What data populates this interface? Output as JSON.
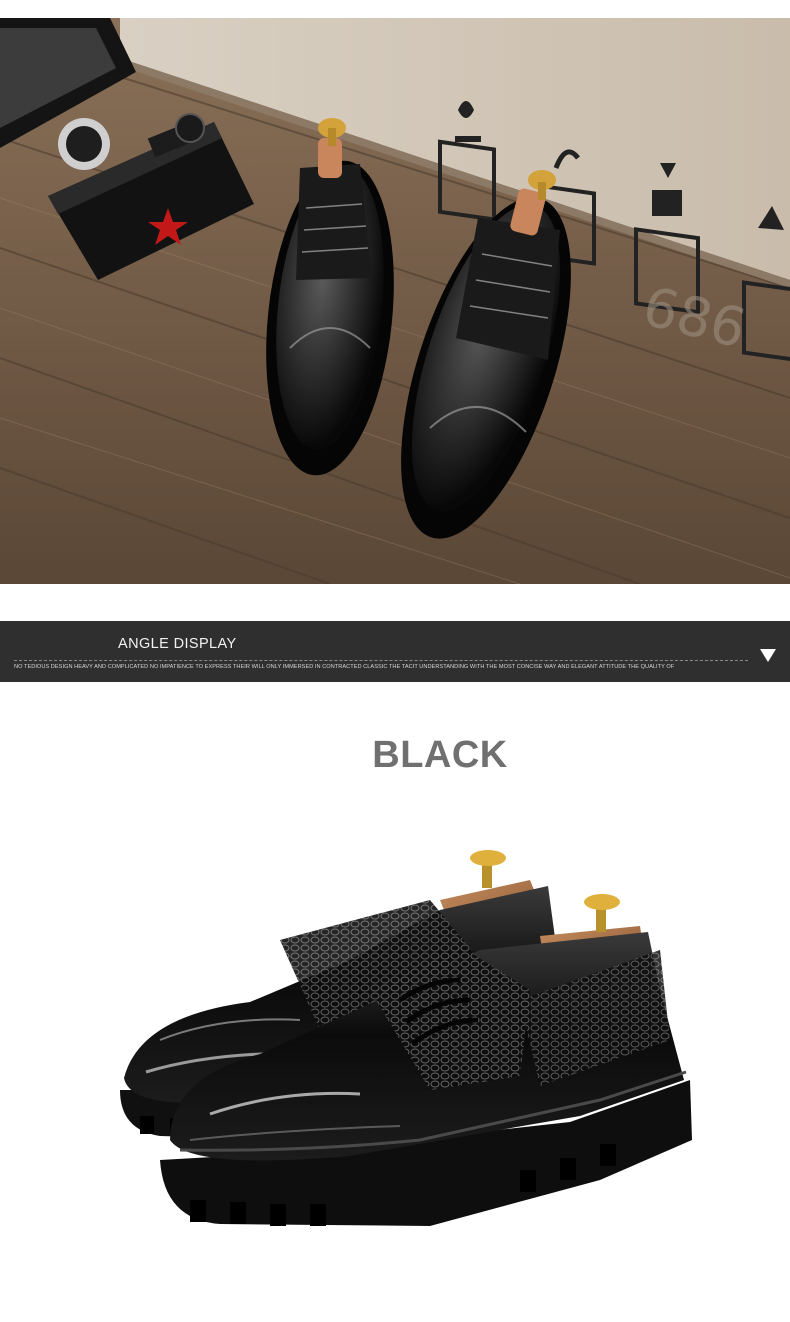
{
  "banner": {
    "title": "ANGLE DISPLAY",
    "subtitle": "NO TEDIOUS DESIGN HEAVY AND COMPLICATED NO IMPATIENCE TO EXPRESS THEIR WILL ONLY IMMERSED IN CONTRACTED CLASSIC THE TACIT UNDERSTANDING WITH THE MOST CONCISE WAY AND ELEGANT ATTITUDE THE QUALITY OF"
  },
  "product": {
    "color_label": "BLACK"
  },
  "colors": {
    "banner_bg": "#2f2f2f",
    "heading_gray": "#707070",
    "shoe_black": "#0d0d0d",
    "wood_brown": "#7a6452"
  },
  "icons": [
    "camera-icon",
    "fragile-icon",
    "keep-dry-icon",
    "this-side-up-icon",
    "recycle-icon",
    "dropdown-arrow-icon"
  ]
}
